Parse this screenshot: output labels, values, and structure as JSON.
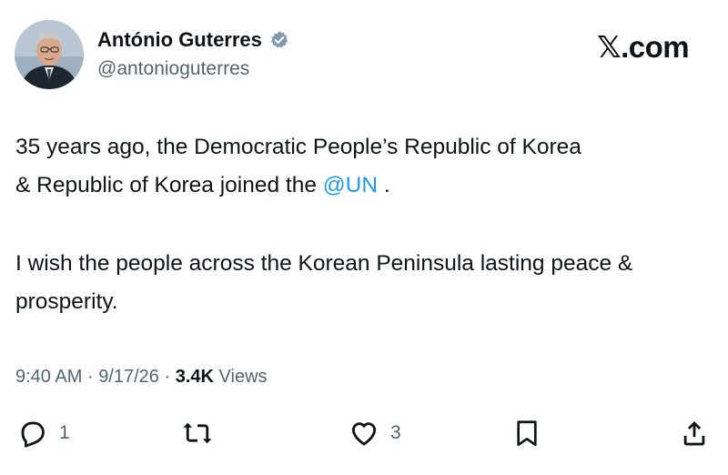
{
  "author": {
    "name": "António Guterres",
    "handle": "@antonioguterres",
    "verified": true
  },
  "brand": {
    "label": "𝕏.com"
  },
  "tweet": {
    "line1_prefix": "35 years ago, the Democratic People’s Republic of Korea",
    "line2_prefix": "& Republic of Korea joined the ",
    "mention": "@UN",
    "line2_suffix": " .",
    "paragraph2": "I wish the people across the Korean Peninsula lasting peace & prosperity."
  },
  "meta": {
    "time": "9:40 AM",
    "separator": "·",
    "date": "9/17/26",
    "views_count": "3.4K",
    "views_label": "Views"
  },
  "actions": {
    "reply_count": "1",
    "like_count": "3"
  },
  "colors": {
    "text": "#0f1419",
    "secondary": "#536471",
    "link": "#1d9bf0",
    "verified_badge": "#829aab"
  }
}
